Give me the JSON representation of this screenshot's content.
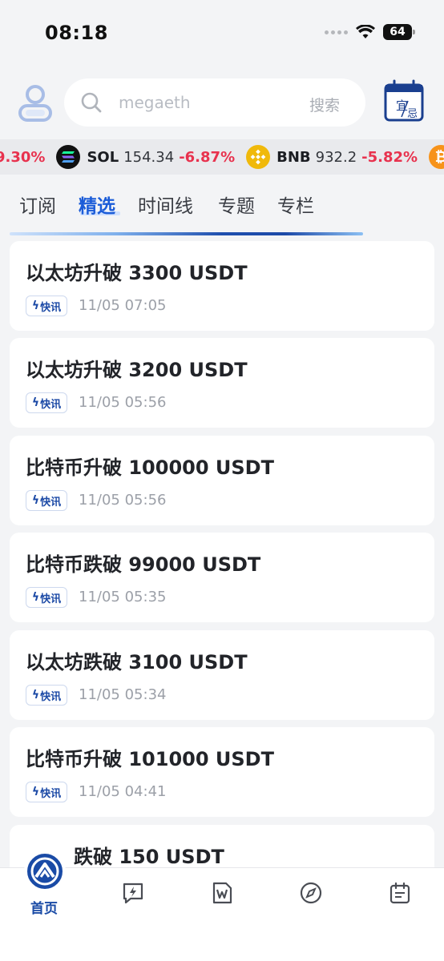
{
  "status": {
    "time": "08:18",
    "battery": "64"
  },
  "search": {
    "placeholder": "megaeth",
    "button": "搜索"
  },
  "calendar": {
    "top": "宜",
    "bottom": "忌"
  },
  "ticker": [
    {
      "symbol": "",
      "price": "",
      "change": "9.30%",
      "icon": "partial"
    },
    {
      "symbol": "SOL",
      "price": "154.34",
      "change": "-6.87%",
      "icon": "solana-icon",
      "color": "#111111"
    },
    {
      "symbol": "BNB",
      "price": "932.2",
      "change": "-5.82%",
      "icon": "bnb-icon",
      "color": "#f0b90b"
    },
    {
      "symbol": "",
      "price": "",
      "change": "",
      "icon": "bitcoin-icon",
      "color": "#f7931a"
    }
  ],
  "tabs": [
    "订阅",
    "精选",
    "时间线",
    "专题",
    "专栏"
  ],
  "active_tab": "精选",
  "feed": [
    {
      "title": "以太坊升破 3300 USDT",
      "tag": "快讯",
      "time": "11/05 07:05"
    },
    {
      "title": "以太坊升破 3200 USDT",
      "tag": "快讯",
      "time": "11/05 05:56"
    },
    {
      "title": "比特币升破 100000 USDT",
      "tag": "快讯",
      "time": "11/05 05:56"
    },
    {
      "title": "比特币跌破 99000 USDT",
      "tag": "快讯",
      "time": "11/05 05:35"
    },
    {
      "title": "以太坊跌破 3100 USDT",
      "tag": "快讯",
      "time": "11/05 05:34"
    },
    {
      "title": "比特币升破 101000 USDT",
      "tag": "快讯",
      "time": "11/05 04:41"
    },
    {
      "title": "跌破 150 USDT",
      "tag": "",
      "time": ""
    }
  ],
  "nav": {
    "home": "首页"
  },
  "colors": {
    "accent": "#1b5cd8",
    "brand": "#1a4ba6",
    "negative": "#e8324e"
  }
}
